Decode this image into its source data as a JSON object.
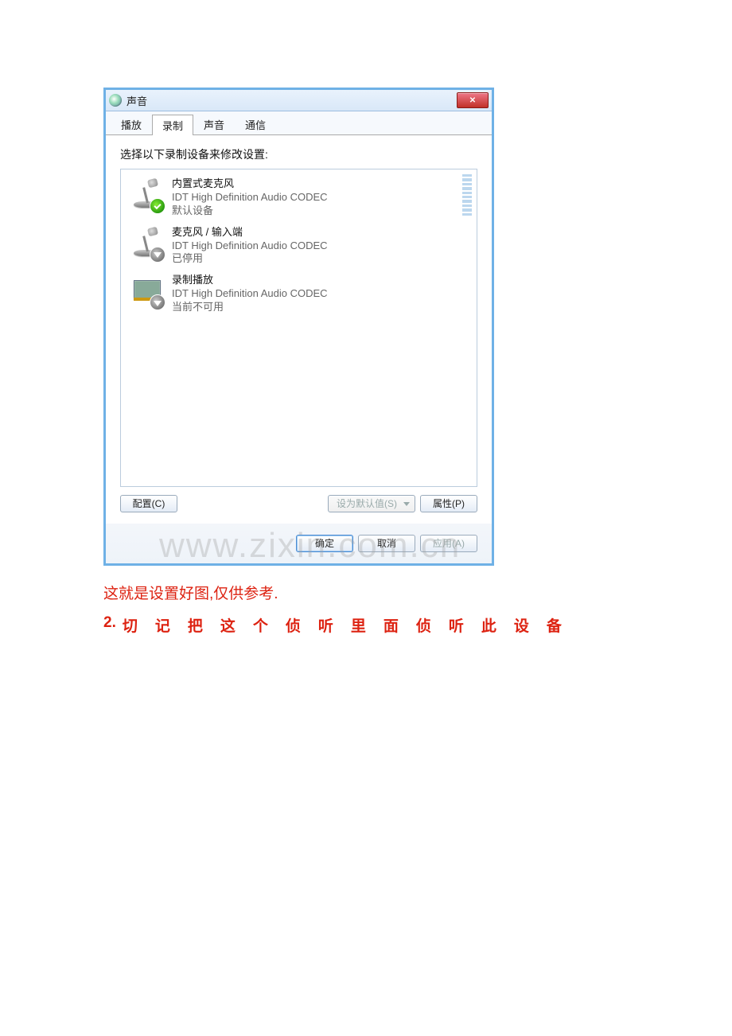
{
  "dialog": {
    "title": "声音",
    "tabs": [
      {
        "label": "播放",
        "active": false
      },
      {
        "label": "录制",
        "active": true
      },
      {
        "label": "声音",
        "active": false
      },
      {
        "label": "通信",
        "active": false
      }
    ],
    "instruction": "选择以下录制设备来修改设置:",
    "devices": [
      {
        "name": "内置式麦克风",
        "desc": "IDT High Definition Audio CODEC",
        "status": "默认设备",
        "icon": "microphone",
        "badge": "ok",
        "has_level": true
      },
      {
        "name": "麦克风 / 输入端",
        "desc": "IDT High Definition Audio CODEC",
        "status": "已停用",
        "icon": "microphone",
        "badge": "down",
        "has_level": false
      },
      {
        "name": "录制播放",
        "desc": "IDT High Definition Audio CODEC",
        "status": "当前不可用",
        "icon": "card",
        "badge": "down",
        "has_level": false
      }
    ],
    "buttons": {
      "configure": "配置(C)",
      "set_default": "设为默认值(S)",
      "properties": "属性(P)"
    },
    "footer": {
      "ok": "确定",
      "cancel": "取消",
      "apply": "应用(A)"
    }
  },
  "watermark": "www.zixin.com.cn",
  "caption": "这就是设置好图,仅供参考.",
  "step2_index": "2.",
  "step2_text": "切记把这个侦听里面侦听此设备"
}
